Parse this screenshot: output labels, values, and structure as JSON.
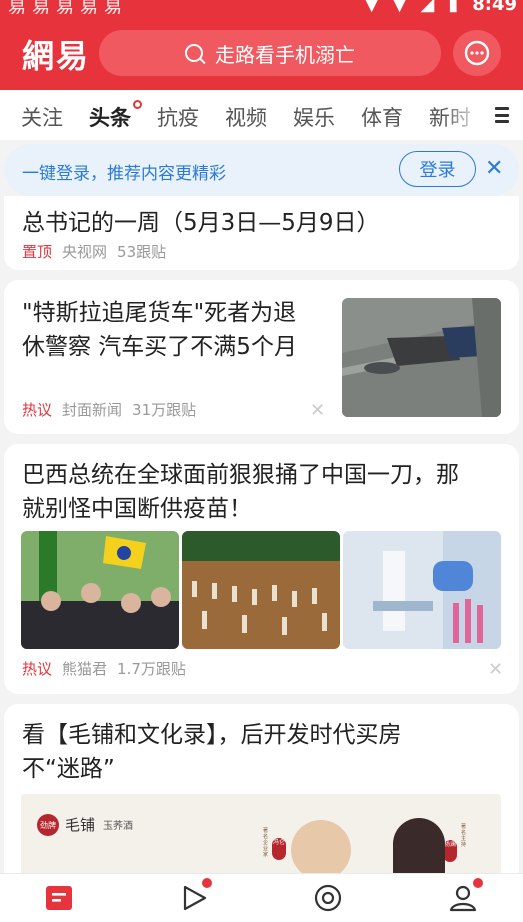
{
  "status_bar": {
    "time": "8:49",
    "left_icons": "易易易易易"
  },
  "header": {
    "logo": "網易",
    "search_placeholder": "走路看手机溺亡"
  },
  "tabs": [
    {
      "label": "关注"
    },
    {
      "label": "头条"
    },
    {
      "label": "抗疫"
    },
    {
      "label": "视频"
    },
    {
      "label": "娱乐"
    },
    {
      "label": "体育"
    },
    {
      "label": "新时"
    }
  ],
  "login_banner": {
    "text": "一键登录，推荐内容更精彩",
    "button": "登录",
    "close": "✕"
  },
  "feed": [
    {
      "title": "总书记的一周（5月3日—5月9日）",
      "tag": "置顶",
      "source": "央视网",
      "comments": "53跟贴"
    },
    {
      "title_lines": [
        "\"特斯拉追尾货车\"死者为退",
        "休警察 汽车买了不满5个月"
      ],
      "tag": "热议",
      "source": "封面新闻",
      "comments": "31万跟贴"
    },
    {
      "title_lines": [
        "巴西总统在全球面前狠狠捅了中国一刀，那",
        "就别怪中国断供疫苗！"
      ],
      "tag": "热议",
      "source": "熊猫君",
      "comments": "1.7万跟贴"
    },
    {
      "title_lines": [
        "看【毛铺和文化录】，后开发时代买房",
        "不“迷路”"
      ],
      "ad_brand": "毛铺",
      "ad_brand_sub": "玉荞酒",
      "ad_left_seal": "劲牌",
      "ad_person1_title": "著名企业家",
      "ad_person1_name": "冯仑",
      "ad_person2_title": "著名主持",
      "ad_person2_name": "杨澜"
    }
  ],
  "bottom_nav": [
    {
      "name": "home"
    },
    {
      "name": "video"
    },
    {
      "name": "discover"
    },
    {
      "name": "me"
    }
  ],
  "colors": {
    "brand": "#e7343c",
    "link": "#2b7bd6"
  }
}
